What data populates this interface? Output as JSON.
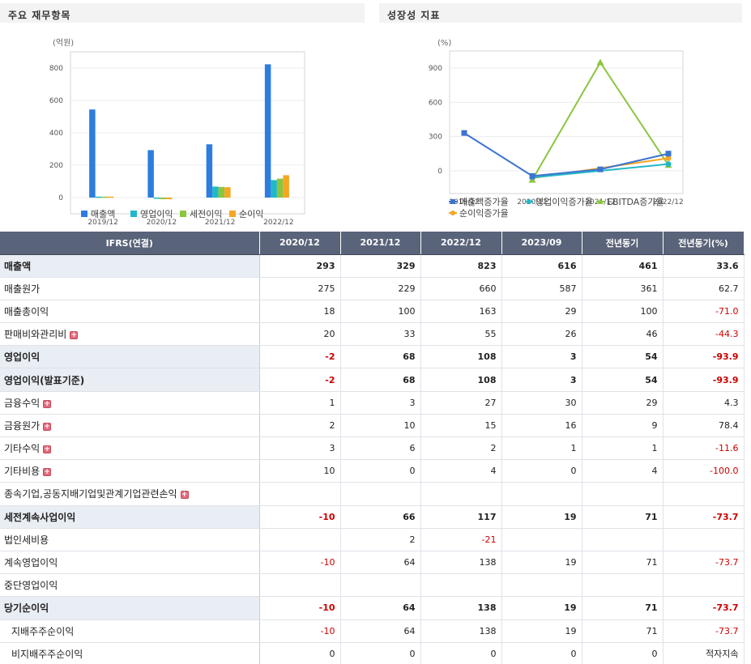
{
  "left_panel": {
    "title": "주요 재무항목"
  },
  "right_panel": {
    "title": "성장성 지표"
  },
  "colors": {
    "revenue": "#2d7de1",
    "op_income": "#22b8c8",
    "pretax": "#8cc63f",
    "net": "#f5a623",
    "line_revenue": "#3d74d0",
    "line_op": "#22b8c8",
    "line_ebitda": "#8cc63f",
    "line_net": "#f5a623",
    "header_bg": "#596379",
    "negative": "#cc0000"
  },
  "chart_data": [
    {
      "type": "bar",
      "ylabel": "(억원)",
      "categories": [
        "2019/12",
        "2020/12",
        "2021/12",
        "2022/12"
      ],
      "ylim": [
        -100,
        900
      ],
      "yticks": [
        0,
        200,
        400,
        600,
        800
      ],
      "series": [
        {
          "name": "매출액",
          "values": [
            544,
            293,
            329,
            823
          ]
        },
        {
          "name": "영업이익",
          "values": [
            6,
            -2,
            68,
            108
          ]
        },
        {
          "name": "세전이익",
          "values": [
            6,
            -10,
            66,
            117
          ]
        },
        {
          "name": "순이익",
          "values": [
            6,
            -10,
            64,
            138
          ]
        }
      ],
      "legend": "bottom"
    },
    {
      "type": "line",
      "ylabel": "(%)",
      "categories": [
        "2019/12",
        "2020/12",
        "2021/12",
        "2022/12"
      ],
      "ylim": [
        -200,
        1050
      ],
      "yticks": [
        0,
        300,
        600,
        900
      ],
      "series": [
        {
          "name": "매출액증가율",
          "values": [
            331,
            -46,
            12,
            150
          ]
        },
        {
          "name": "영업이익증가율",
          "values": [
            null,
            -60,
            null,
            58
          ]
        },
        {
          "name": "EBITDA증가율",
          "values": [
            null,
            -80,
            950,
            50
          ]
        },
        {
          "name": "순이익증가율",
          "values": [
            null,
            -65,
            null,
            110
          ]
        }
      ],
      "legend": "bottom"
    }
  ],
  "table": {
    "headers": [
      "IFRS(연결)",
      "2020/12",
      "2021/12",
      "2022/12",
      "2023/09",
      "전년동기",
      "전년동기(%)"
    ],
    "rows": [
      {
        "label": "매출액",
        "major": true,
        "values": [
          "293",
          "329",
          "823",
          "616",
          "461",
          "33.6"
        ]
      },
      {
        "label": "매출원가",
        "values": [
          "275",
          "229",
          "660",
          "587",
          "361",
          "62.7"
        ]
      },
      {
        "label": "매출총이익",
        "values": [
          "18",
          "100",
          "163",
          "29",
          "100",
          "-71.0"
        ]
      },
      {
        "label": "판매비와관리비",
        "plus": true,
        "values": [
          "20",
          "33",
          "55",
          "26",
          "46",
          "-44.3"
        ]
      },
      {
        "label": "영업이익",
        "major": true,
        "values": [
          "-2",
          "68",
          "108",
          "3",
          "54",
          "-93.9"
        ]
      },
      {
        "label": "영업이익(발표기준)",
        "major": true,
        "values": [
          "-2",
          "68",
          "108",
          "3",
          "54",
          "-93.9"
        ]
      },
      {
        "label": "금융수익",
        "plus": true,
        "values": [
          "1",
          "3",
          "27",
          "30",
          "29",
          "4.3"
        ]
      },
      {
        "label": "금융원가",
        "plus": true,
        "values": [
          "2",
          "10",
          "15",
          "16",
          "9",
          "78.4"
        ]
      },
      {
        "label": "기타수익",
        "plus": true,
        "values": [
          "3",
          "6",
          "2",
          "1",
          "1",
          "-11.6"
        ]
      },
      {
        "label": "기타비용",
        "plus": true,
        "values": [
          "10",
          "0",
          "4",
          "0",
          "4",
          "-100.0"
        ]
      },
      {
        "label": "종속기업,공동지배기업및관계기업관련손익",
        "plus": true,
        "values": [
          "",
          "",
          "",
          "",
          "",
          ""
        ]
      },
      {
        "label": "세전계속사업이익",
        "major": true,
        "values": [
          "-10",
          "66",
          "117",
          "19",
          "71",
          "-73.7"
        ]
      },
      {
        "label": "법인세비용",
        "values": [
          "",
          "2",
          "-21",
          "",
          "",
          ""
        ]
      },
      {
        "label": "계속영업이익",
        "values": [
          "-10",
          "64",
          "138",
          "19",
          "71",
          "-73.7"
        ]
      },
      {
        "label": "중단영업이익",
        "values": [
          "",
          "",
          "",
          "",
          "",
          ""
        ]
      },
      {
        "label": "당기순이익",
        "major": true,
        "values": [
          "-10",
          "64",
          "138",
          "19",
          "71",
          "-73.7"
        ]
      },
      {
        "label": "지배주주순이익",
        "indent": true,
        "values": [
          "-10",
          "64",
          "138",
          "19",
          "71",
          "-73.7"
        ]
      },
      {
        "label": "비지배주주순이익",
        "indent": true,
        "values": [
          "0",
          "0",
          "0",
          "0",
          "0",
          "적자지속"
        ]
      }
    ]
  }
}
